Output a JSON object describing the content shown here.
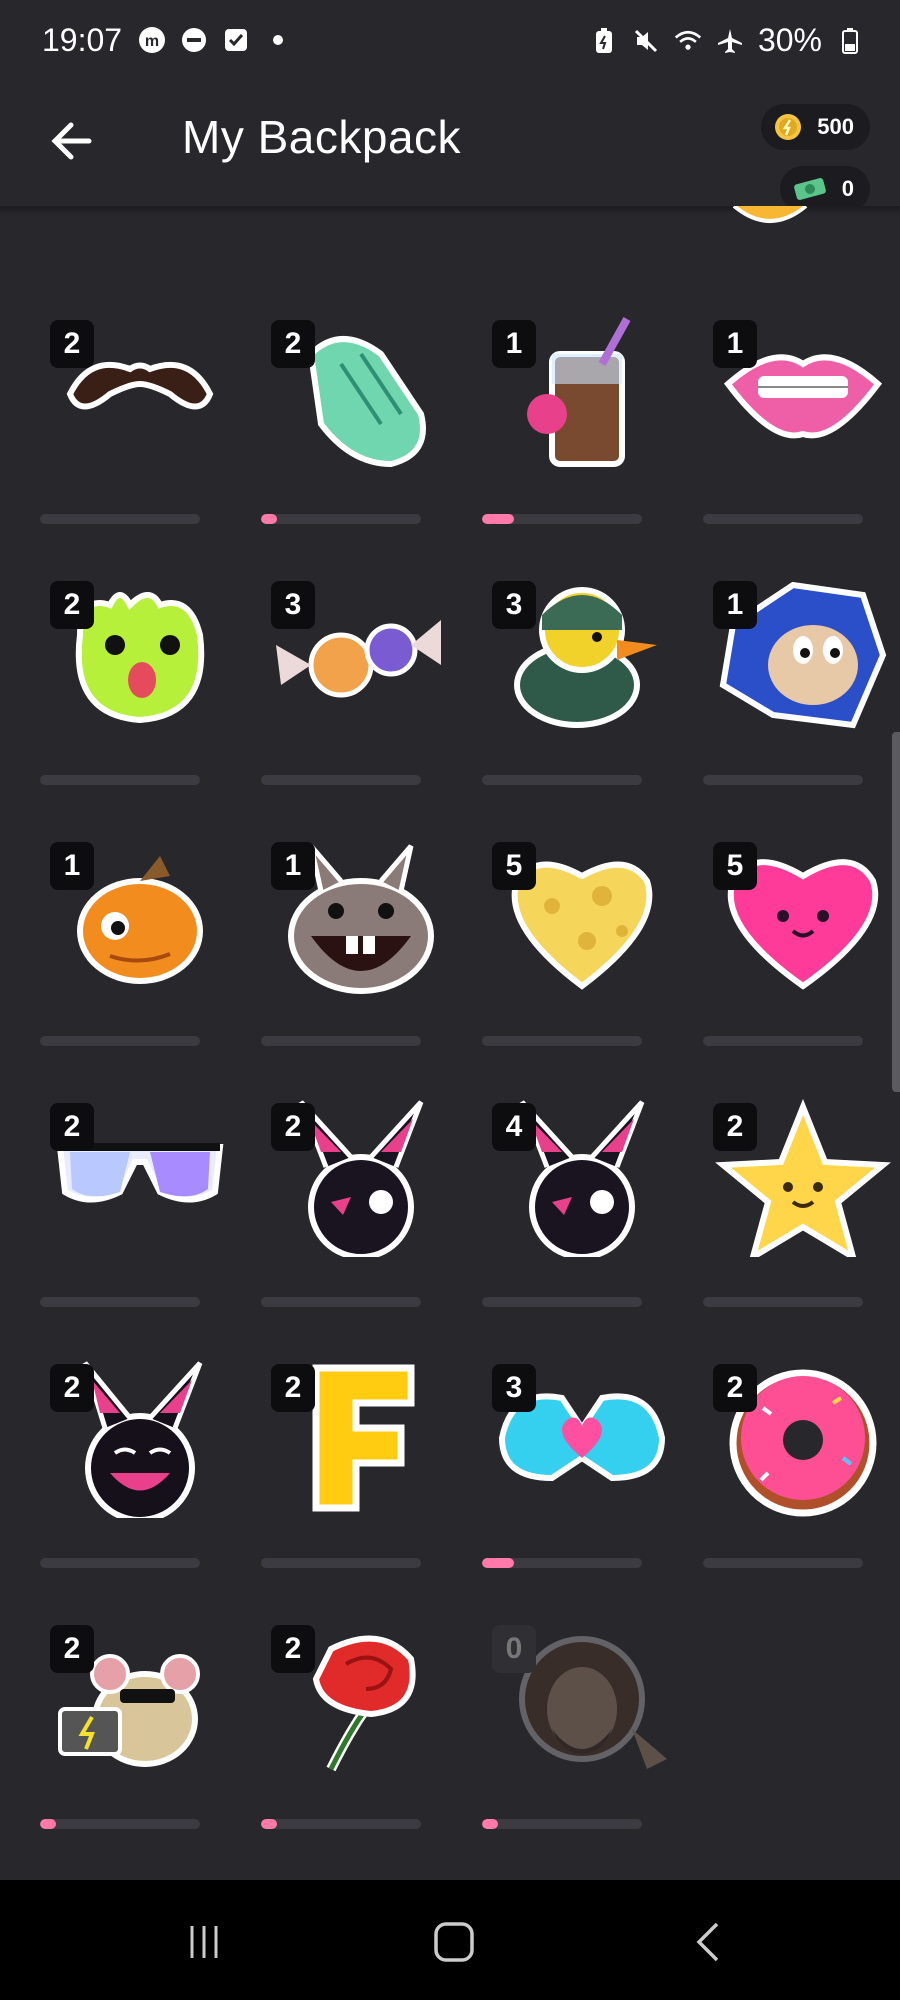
{
  "status": {
    "time": "19:07",
    "battery": "30%"
  },
  "header": {
    "title": "My Backpack",
    "coins": "500",
    "cash": "0"
  },
  "stickers": [
    {
      "name": "mustache",
      "count": "2",
      "progress": 0
    },
    {
      "name": "clapping-hands",
      "count": "2",
      "progress": 0.1
    },
    {
      "name": "chocolate-drink",
      "count": "1",
      "progress": 0.2
    },
    {
      "name": "braces-lips",
      "count": "1",
      "progress": 0
    },
    {
      "name": "green-frog",
      "count": "2",
      "progress": 0
    },
    {
      "name": "candies",
      "count": "3",
      "progress": 0
    },
    {
      "name": "soldier-duck",
      "count": "3",
      "progress": 0
    },
    {
      "name": "sonic-face",
      "count": "1",
      "progress": 0
    },
    {
      "name": "orange-fish",
      "count": "1",
      "progress": 0
    },
    {
      "name": "laughing-rabbit",
      "count": "1",
      "progress": 0
    },
    {
      "name": "cheese-heart",
      "count": "5",
      "progress": 0
    },
    {
      "name": "pink-heart",
      "count": "5",
      "progress": 0
    },
    {
      "name": "sunglasses",
      "count": "2",
      "progress": 0
    },
    {
      "name": "black-bunny",
      "count": "2",
      "progress": 0
    },
    {
      "name": "black-bunny",
      "count": "4",
      "progress": 0
    },
    {
      "name": "smiling-star",
      "count": "2",
      "progress": 0
    },
    {
      "name": "black-bunny-laughing",
      "count": "2",
      "progress": 0
    },
    {
      "name": "letter-f",
      "count": "2",
      "progress": 0
    },
    {
      "name": "heart-hands",
      "count": "3",
      "progress": 0.2
    },
    {
      "name": "pink-donut",
      "count": "2",
      "progress": 0
    },
    {
      "name": "hacker-mouse",
      "count": "2",
      "progress": 0.1
    },
    {
      "name": "red-rose",
      "count": "2",
      "progress": 0.1
    },
    {
      "name": "bob-ross",
      "count": "0",
      "progress": 0.1
    }
  ],
  "colors": {
    "background": "#27272c",
    "progress_fill": "#ff7aa8",
    "coin": "#f5c542",
    "cash": "#5bc48a"
  }
}
